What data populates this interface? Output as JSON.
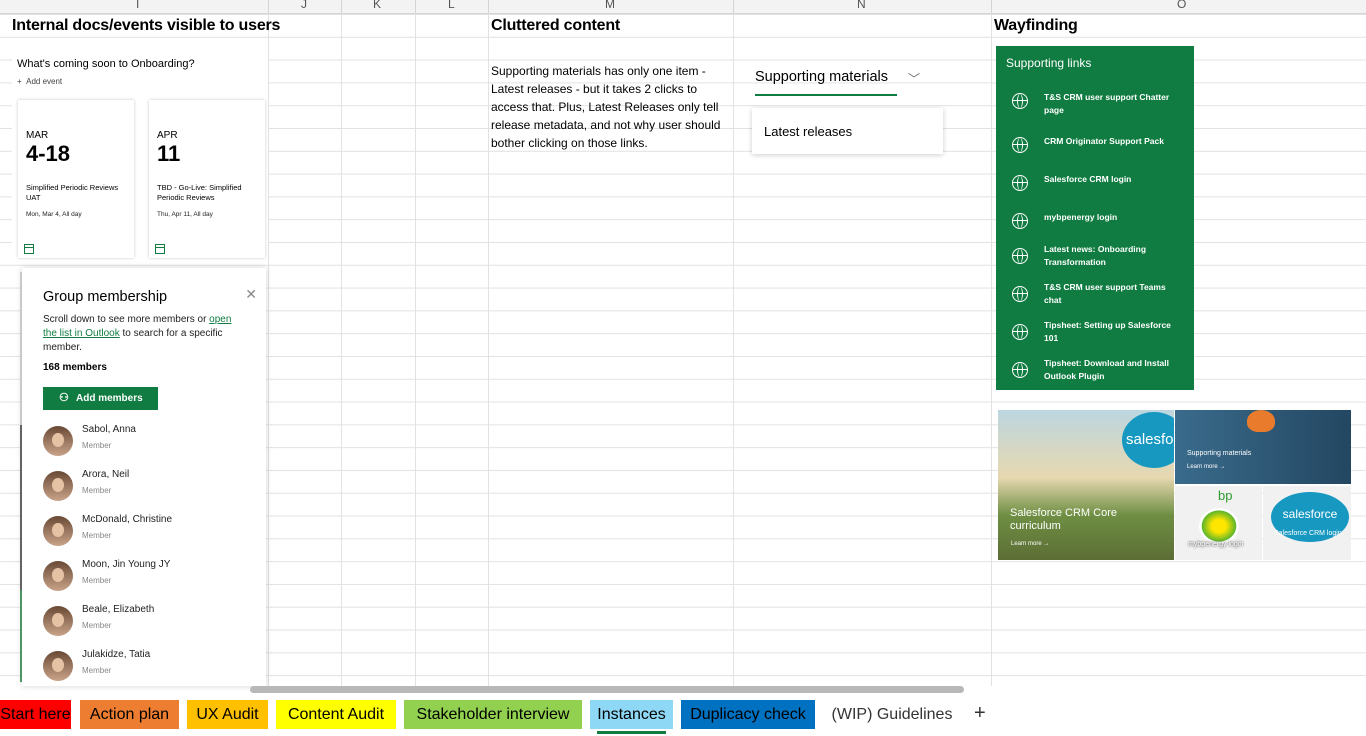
{
  "columns": [
    "I",
    "J",
    "K",
    "L",
    "M",
    "N",
    "O"
  ],
  "headers": {
    "internal": "Internal docs/events visible to users",
    "cluttered": "Cluttered content",
    "wayfinding": "Wayfinding"
  },
  "events": {
    "title": "What's coming soon to Onboarding?",
    "add_label": "Add event",
    "cards": [
      {
        "month": "MAR",
        "day": "4-18",
        "desc": "Simplified Periodic Reviews UAT",
        "when": "Mon, Mar 4, All day"
      },
      {
        "month": "APR",
        "day": "11",
        "desc": "TBD - Go-Live: Simplified Periodic Reviews",
        "when": "Thu, Apr 11, All day"
      }
    ]
  },
  "group": {
    "title": "Group membership",
    "note_pre": "Scroll down to see more members or ",
    "note_link": "open the list in Outlook",
    "note_post": " to search for a specific member.",
    "count": "168 members",
    "add_button": "Add members",
    "members": [
      {
        "name": "Sabol, Anna",
        "role": "Member"
      },
      {
        "name": "Arora, Neil",
        "role": "Member"
      },
      {
        "name": "McDonald, Christine",
        "role": "Member"
      },
      {
        "name": "Moon, Jin Young JY",
        "role": "Member"
      },
      {
        "name": "Beale, Elizabeth",
        "role": "Member"
      },
      {
        "name": "Julakidze, Tatia",
        "role": "Member"
      }
    ]
  },
  "cluttered_text": "Supporting materials has only one item - Latest releases - but it takes 2 clicks to access that. Plus, Latest Releases only tell release metadata, and not why user should bother clicking on those links.",
  "supporting": {
    "label": "Supporting materials",
    "item": "Latest releases"
  },
  "links": {
    "title": "Supporting links",
    "items": [
      "T&S CRM user support Chatter page",
      "CRM Originator Support Pack",
      "Salesforce CRM login",
      "mybpenergy login",
      "Latest news: Onboarding Transformation",
      "T&S CRM user support Teams chat",
      "Tipsheet: Setting up Salesforce 101",
      "Tipsheet: Download and Install Outlook Plugin"
    ]
  },
  "tiles": {
    "big_caption": "Salesforce CRM Core curriculum",
    "big_more": "Learn more →",
    "big_logo": "salesfo",
    "sm1_caption": "Supporting materials",
    "sm1_more": "Learn more →",
    "sm2_logo": "bp",
    "sm2_caption": "mybpenergy login",
    "sm3_logo": "salesforce",
    "sm3_caption": "Salesforce CRM login"
  },
  "tabs": [
    {
      "label": "Start here",
      "color": "#ff0000"
    },
    {
      "label": "Action plan",
      "color": "#ed7d31"
    },
    {
      "label": "UX Audit",
      "color": "#ffc000"
    },
    {
      "label": "Content Audit",
      "color": "#ffff00"
    },
    {
      "label": "Stakeholder interview",
      "color": "#92d050"
    },
    {
      "label": "Instances",
      "color": "#8ed7f5"
    },
    {
      "label": "Duplicacy check",
      "color": "#0070c0"
    },
    {
      "label": "(WIP) Guidelines",
      "color": "#ffffff"
    }
  ],
  "add_sheet": "+"
}
